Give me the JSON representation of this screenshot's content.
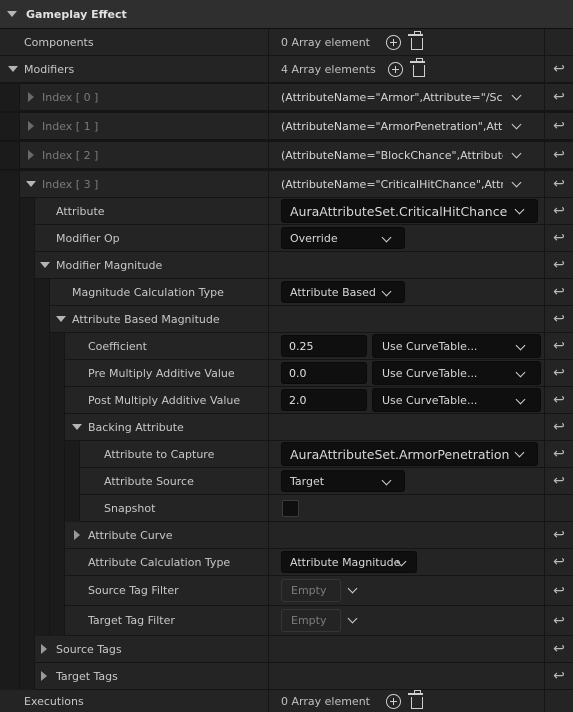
{
  "header": {
    "title": "Gameplay Effect"
  },
  "rows": {
    "components": {
      "label": "Components",
      "value": "0 Array element"
    },
    "modifiers": {
      "label": "Modifiers",
      "value": "4 Array elements"
    },
    "index0": {
      "label": "Index [ 0 ]",
      "value": "(AttributeName=\"Armor\",Attribute=\"/Script/..."
    },
    "index1": {
      "label": "Index [ 1 ]",
      "value": "(AttributeName=\"ArmorPenetration\",Attribute=\"/Script/..."
    },
    "index2": {
      "label": "Index [ 2 ]",
      "value": "(AttributeName=\"BlockChance\",Attribute=\"/Script/..."
    },
    "index3": {
      "label": "Index [ 3 ]",
      "value": "(AttributeName=\"CriticalHitChance\",Attribute=\"/Script/..."
    },
    "attribute": {
      "label": "Attribute",
      "value": "AuraAttributeSet.CriticalHitChance"
    },
    "modifier_op": {
      "label": "Modifier Op",
      "value": "Override"
    },
    "modifier_magnitude": {
      "label": "Modifier Magnitude"
    },
    "magnitude_calc_type": {
      "label": "Magnitude Calculation Type",
      "value": "Attribute Based"
    },
    "attribute_based_magnitude": {
      "label": "Attribute Based Magnitude"
    },
    "coefficient": {
      "label": "Coefficient",
      "value": "0.25",
      "curve": "Use CurveTable..."
    },
    "pre_multiply": {
      "label": "Pre Multiply Additive Value",
      "value": "0.0",
      "curve": "Use CurveTable..."
    },
    "post_multiply": {
      "label": "Post Multiply Additive Value",
      "value": "2.0",
      "curve": "Use CurveTable..."
    },
    "backing_attribute": {
      "label": "Backing Attribute"
    },
    "attribute_to_capture": {
      "label": "Attribute to Capture",
      "value": "AuraAttributeSet.ArmorPenetration"
    },
    "attribute_source": {
      "label": "Attribute Source",
      "value": "Target"
    },
    "snapshot": {
      "label": "Snapshot",
      "checked": false
    },
    "attribute_curve": {
      "label": "Attribute Curve"
    },
    "attribute_calc_type": {
      "label": "Attribute Calculation Type",
      "value": "Attribute Magnitude"
    },
    "source_tag_filter": {
      "label": "Source Tag Filter",
      "value": "Empty"
    },
    "target_tag_filter": {
      "label": "Target Tag Filter",
      "value": "Empty"
    },
    "source_tags": {
      "label": "Source Tags"
    },
    "target_tags": {
      "label": "Target Tags"
    },
    "executions": {
      "label": "Executions",
      "value": "0 Array element"
    }
  },
  "icons": {
    "reset": "reset-arrow-icon",
    "add": "add-circle-icon",
    "delete": "trash-icon",
    "expand": "expand-arrow-icon"
  },
  "colors": {
    "panel": "#242424",
    "background": "#151515",
    "header": "#2f2f2f",
    "input": "#0f0f0f"
  }
}
